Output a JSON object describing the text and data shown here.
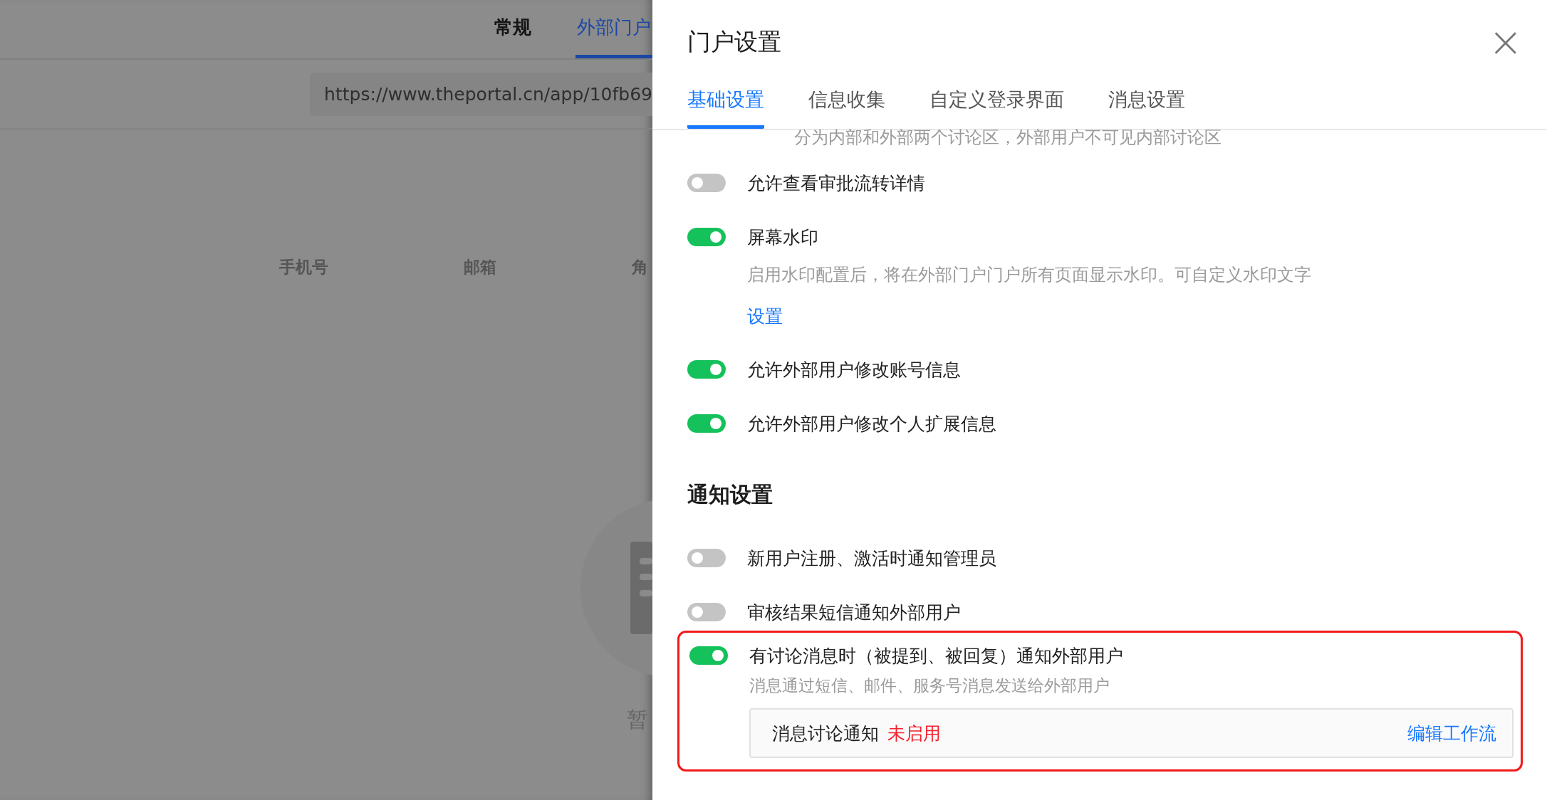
{
  "background": {
    "tabs": [
      {
        "label": "常规",
        "selected": false
      },
      {
        "label": "外部门户",
        "selected": true
      }
    ],
    "url": "https://www.theportal.cn/app/10fb69",
    "columns": [
      "手机号",
      "邮箱",
      "角"
    ],
    "empty_text": "暂"
  },
  "panel": {
    "title": "门户设置",
    "close": "×",
    "tabs": [
      {
        "label": "基础设置",
        "selected": true
      },
      {
        "label": "信息收集",
        "selected": false
      },
      {
        "label": "自定义登录界面",
        "selected": false
      },
      {
        "label": "消息设置",
        "selected": false
      }
    ],
    "top_note": "分为内部和外部两个讨论区，外部用户不可见内部讨论区",
    "sections": [
      {
        "items": [
          {
            "label": "允许查看审批流转详情",
            "on": false,
            "highlighted": false
          },
          {
            "label": "屏幕水印",
            "on": true,
            "description": "启用水印配置后，将在外部门户门户所有页面显示水印。可自定义水印文字",
            "link": "设置",
            "highlighted": false
          },
          {
            "label": "允许外部用户修改账号信息",
            "on": true,
            "highlighted": false
          },
          {
            "label": "允许外部用户修改个人扩展信息",
            "on": true,
            "highlighted": false
          }
        ]
      },
      {
        "heading": "通知设置",
        "items": [
          {
            "label": "新用户注册、激活时通知管理员",
            "on": false,
            "highlighted": false
          },
          {
            "label": "审核结果短信通知外部用户",
            "on": false,
            "highlighted": false
          },
          {
            "label": "有讨论消息时（被提到、被回复）通知外部用户",
            "on": true,
            "description": "消息通过短信、邮件、服务号消息发送给外部用户",
            "highlighted": true,
            "workflow": {
              "name": "消息讨论通知",
              "status": "未启用",
              "action": "编辑工作流"
            }
          }
        ]
      }
    ]
  }
}
